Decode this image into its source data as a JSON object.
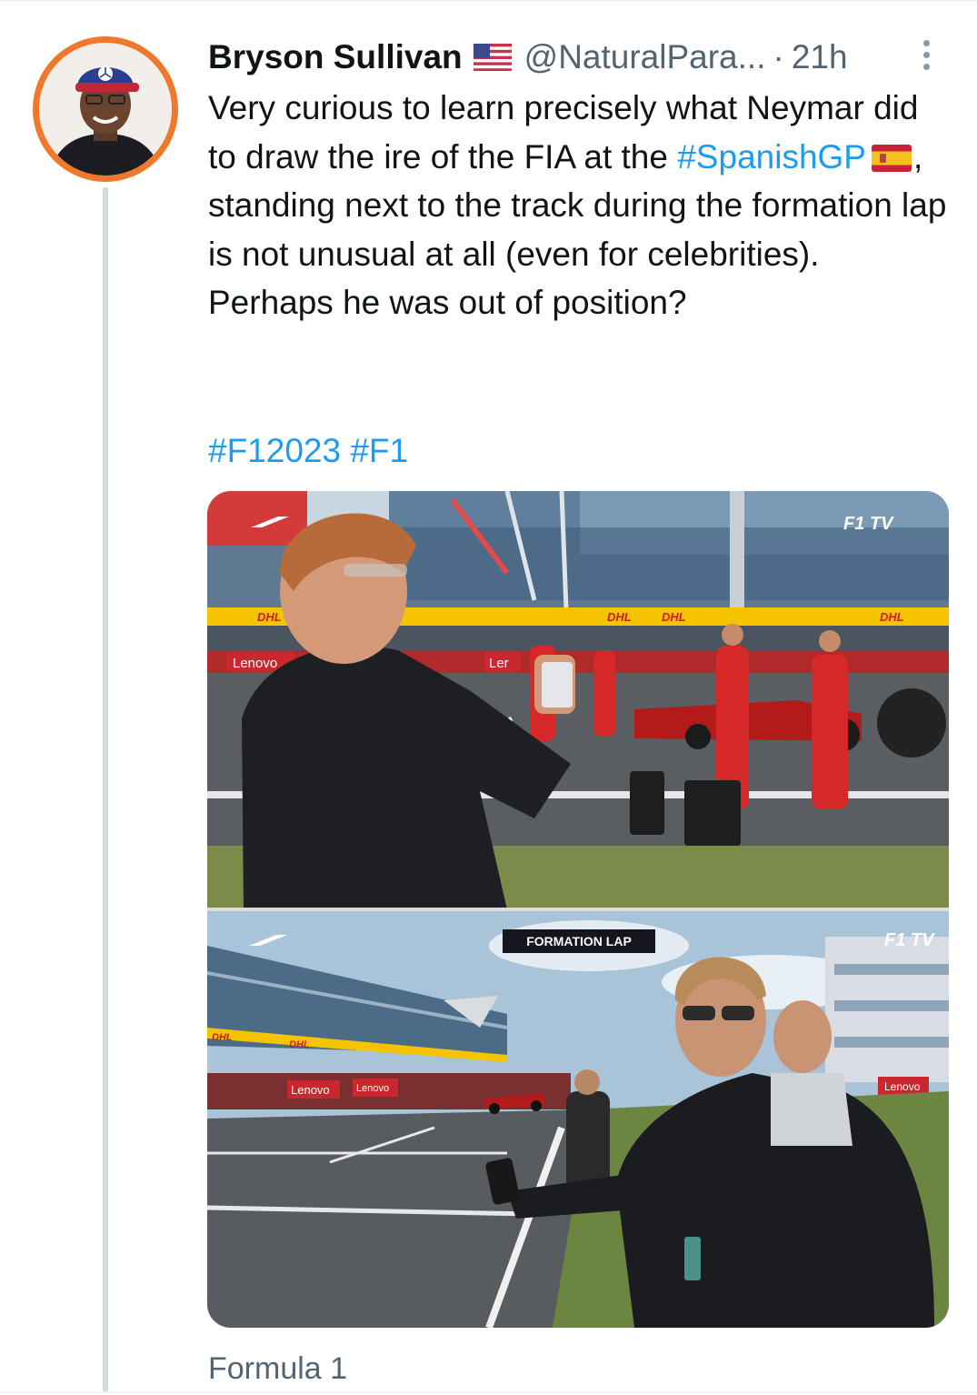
{
  "author": {
    "display_name": "Bryson Sullivan",
    "flag": "us-flag",
    "handle": "@NaturalPara...",
    "separator": "·",
    "time": "21h"
  },
  "tweet": {
    "line1_text_a": "Very curious to learn precisely what Neymar did to draw the ire of the FIA at the ",
    "hashtag_spanishgp": "#SpanishGP",
    "flag": "spain-flag",
    "line1_text_b": ", standing next to the track during the formation lap is not unusual at all (even for celebrities). Perhaps he was out of position?",
    "hashtag_f12023": "#F12023",
    "hashtag_f1": "#F1"
  },
  "media": {
    "top_panel": {
      "broadcast_logo": "F1 TV",
      "sponsor_banners": [
        "Lenovo",
        "Ler",
        "DHL",
        "DHL",
        "DHL",
        "DHL"
      ]
    },
    "bottom_panel": {
      "overlay_caption": "FORMATION LAP",
      "broadcast_logo": "F1 TV",
      "sponsor_banners": [
        "Lenovo",
        "Lenovo",
        "Lenovo",
        "DHL",
        "DHL"
      ]
    }
  },
  "source": {
    "label": "Formula 1"
  },
  "colors": {
    "accent": "#1d9bf0",
    "secondary_text": "#536471",
    "avatar_ring": "#f0782a",
    "thread_line": "#cfd9de"
  }
}
